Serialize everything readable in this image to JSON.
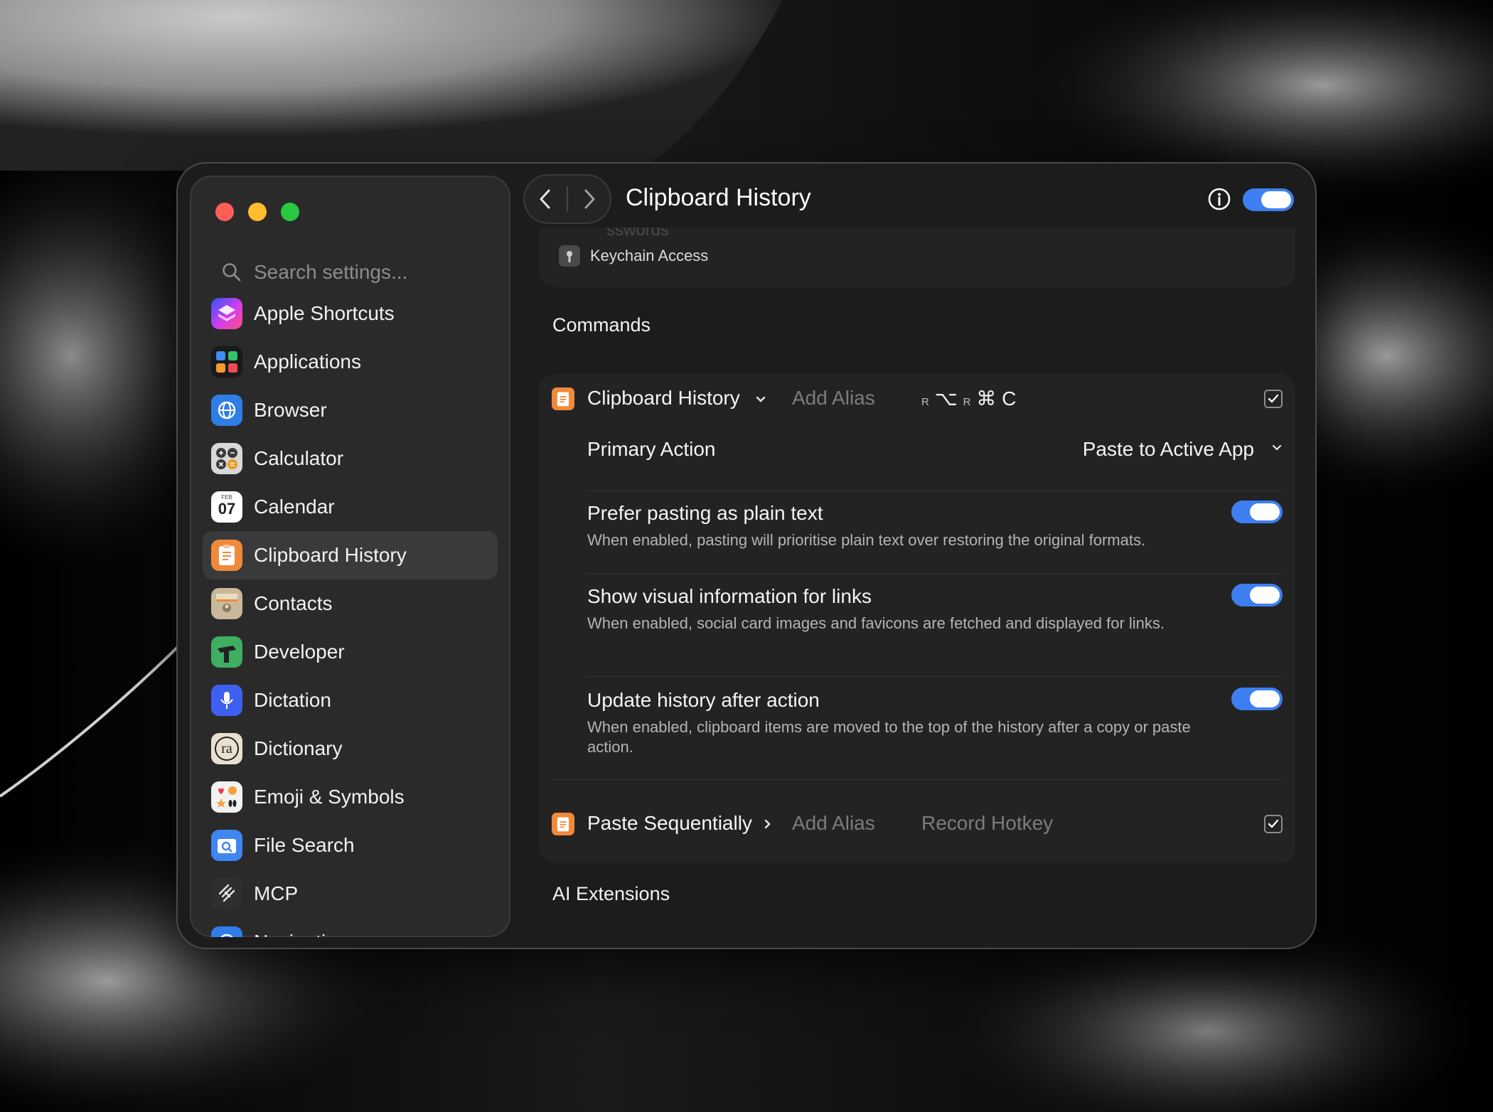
{
  "window": {
    "title": "Clipboard History"
  },
  "sidebar": {
    "search_placeholder": "Search settings...",
    "items": [
      {
        "label": "Apple Shortcuts",
        "icon": "shortcuts-icon"
      },
      {
        "label": "Applications",
        "icon": "applications-icon"
      },
      {
        "label": "Browser",
        "icon": "browser-icon"
      },
      {
        "label": "Calculator",
        "icon": "calculator-icon"
      },
      {
        "label": "Calendar",
        "icon": "calendar-icon",
        "month": "FEB",
        "day": "07"
      },
      {
        "label": "Clipboard History",
        "icon": "clipboard-icon",
        "active": true
      },
      {
        "label": "Contacts",
        "icon": "contacts-icon"
      },
      {
        "label": "Developer",
        "icon": "developer-icon"
      },
      {
        "label": "Dictation",
        "icon": "microphone-icon"
      },
      {
        "label": "Dictionary",
        "icon": "dictionary-icon",
        "glyph": "ra"
      },
      {
        "label": "Emoji & Symbols",
        "icon": "emoji-icon"
      },
      {
        "label": "File Search",
        "icon": "file-search-icon"
      },
      {
        "label": "MCP",
        "icon": "mcp-icon"
      },
      {
        "label": "Navigation",
        "icon": "navigation-icon"
      }
    ]
  },
  "content": {
    "partial_card": {
      "ghost_heading": "sswords",
      "item_label": "Keychain Access"
    },
    "commands_title": "Commands",
    "commands": [
      {
        "name": "Clipboard History",
        "alias_placeholder": "Add Alias",
        "hotkey_parts": [
          "R",
          "⌥",
          "R",
          "⌘",
          "C"
        ],
        "enabled": true
      },
      {
        "name": "Paste Sequentially",
        "alias_placeholder": "Add Alias",
        "hotkey_placeholder": "Record Hotkey",
        "enabled": true
      }
    ],
    "primary_action": {
      "label": "Primary Action",
      "value": "Paste to Active App"
    },
    "settings": [
      {
        "title": "Prefer pasting as plain text",
        "desc": "When enabled, pasting will prioritise plain text over restoring the original formats.",
        "on": true
      },
      {
        "title": "Show visual information for links",
        "desc": "When enabled, social card images and favicons are fetched and displayed for links.",
        "on": true
      },
      {
        "title": "Update history after action",
        "desc": "When enabled, clipboard items are moved to the top of the history after a copy or paste action.",
        "on": true
      }
    ],
    "ai_extensions_title": "AI Extensions"
  },
  "colors": {
    "accent": "#3d7ff0",
    "window_bg": "#1c1c1d",
    "sidebar_bg": "#2a2a2b",
    "card_bg": "#232324"
  }
}
